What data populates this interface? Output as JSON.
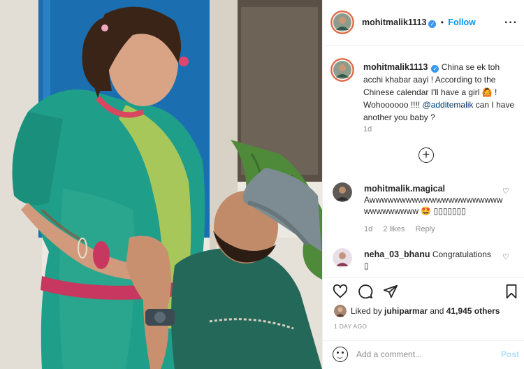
{
  "colors": {
    "accent": "#0095f6",
    "verified": "#3897f0",
    "muted": "#8e8e8e",
    "post_disabled": "#b2dffc",
    "saree_teal": "#1f9e8a",
    "saree_lime": "#a7c75a",
    "door_blue": "#1b6fb0",
    "cap_gray": "#7d8c92"
  },
  "header": {
    "username": "mohitmalik1113",
    "separator": "•",
    "follow_label": "Follow",
    "more_icon": "more-options-icon"
  },
  "caption": {
    "username": "mohitmalik1113",
    "text_1": "China se ek toh acchi khabar aayi ! According to the Chinese calendar I'll have a girl",
    "emoji_1": "🙆",
    "text_2": "! Wohoooooo !!!! ",
    "mention": "@additemalik",
    "text_3": " can I have another you baby ?",
    "time": "1d"
  },
  "load_more_icon": "plus-circle-icon",
  "comments": [
    {
      "username": "mohitmalik.magical",
      "text": "Awwwwwwwwwwwwwwwwwwwwwwwwwwwwwww",
      "emoji": "🤩",
      "boxes": "▯▯▯▯▯▯▯",
      "time": "1d",
      "likes": "2 likes",
      "reply": "Reply"
    },
    {
      "username": "neha_03_bhanu",
      "text": "Congratulations",
      "boxes": "▯"
    }
  ],
  "actions": {
    "like_icon": "heart-icon",
    "comment_icon": "comment-icon",
    "share_icon": "share-icon",
    "save_icon": "bookmark-icon",
    "liked_by_prefix": "Liked by ",
    "liked_by_user": "juhiparmar",
    "liked_by_mid": " and ",
    "liked_by_count": "41,945 others",
    "day_ago": "1 DAY AGO"
  },
  "add_comment": {
    "placeholder": "Add a comment...",
    "post_label": "Post"
  }
}
